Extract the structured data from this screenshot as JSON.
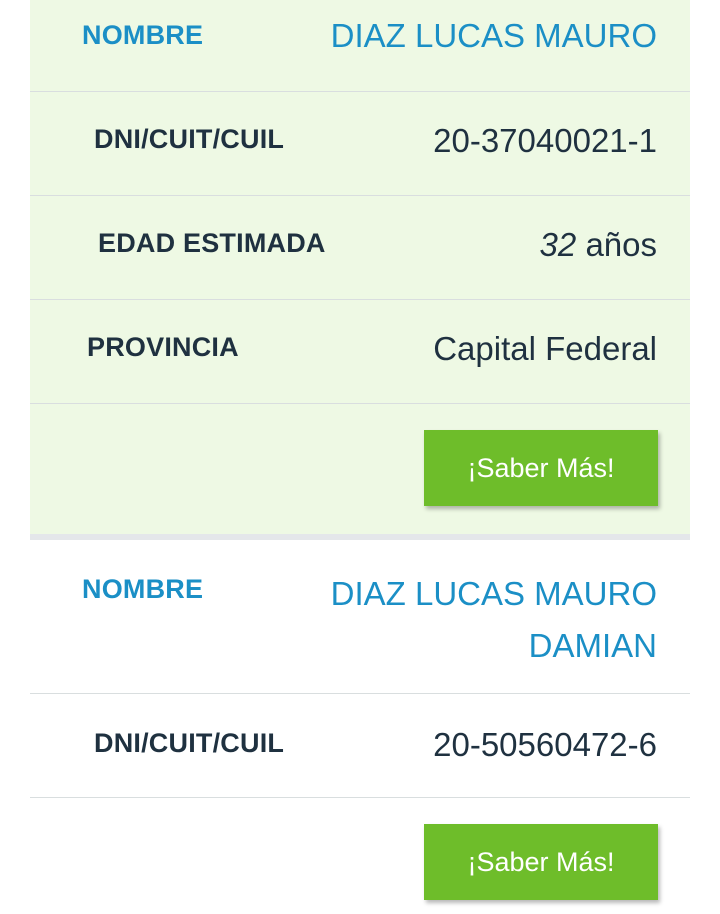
{
  "results": [
    {
      "name_label": "NOMBRE",
      "name_value": "DIAZ LUCAS MAURO",
      "dni_label": "DNI/CUIT/CUIL",
      "dni_value": "20-37040021-1",
      "age_label": "EDAD ESTIMADA",
      "age_number": "32",
      "age_unit": "años",
      "province_label": "PROVINCIA",
      "province_value": "Capital Federal",
      "button_label": "¡Saber Más!"
    },
    {
      "name_label": "NOMBRE",
      "name_value_line1": "DIAZ LUCAS MAURO",
      "name_value_line2": "DAMIAN",
      "dni_label": "DNI/CUIT/CUIL",
      "dni_value": "20-50560472-6",
      "button_label": "¡Saber Más!"
    }
  ],
  "colors": {
    "accent_blue": "#1b8fc6",
    "button_green": "#6ebd2a",
    "highlight_bg": "#eef9e4",
    "text_dark": "#1f3140"
  }
}
